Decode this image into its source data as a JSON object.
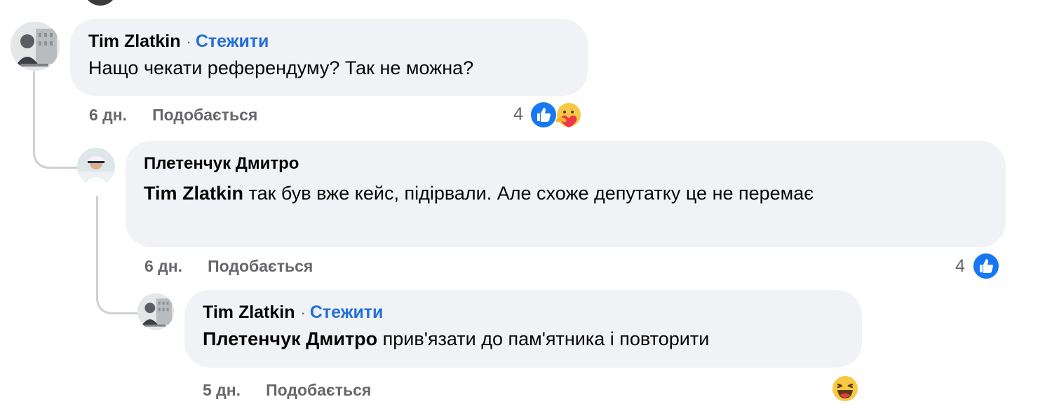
{
  "comments": [
    {
      "author": "Tim Zlatkin",
      "follow_label": "Стежити",
      "separator": "·",
      "text": "Нащо чекати референдуму? Так не можна?",
      "time": "6 дн.",
      "like_label": "Подобається",
      "reaction_count": "4",
      "reactions": [
        "like-icon",
        "care-icon"
      ]
    },
    {
      "author": "Плетенчук Дмитро",
      "mention": "Tim Zlatkin",
      "text": " так був вже кейс, підірвали. Але схоже депутатку це не перемає",
      "time": "6 дн.",
      "like_label": "Подобається",
      "reaction_count": "4",
      "reactions": [
        "like-icon"
      ]
    },
    {
      "author": "Tim Zlatkin",
      "follow_label": "Стежити",
      "separator": "·",
      "mention": "Плетенчук Дмитро",
      "text": " прив'язати до пам'ятника і повторити",
      "time": "5 дн.",
      "like_label": "Подобається",
      "reactions": [
        "haha-icon"
      ]
    }
  ],
  "colors": {
    "bubble": "#f0f2f5",
    "link": "#216fdb",
    "meta": "#65676b",
    "like_blue": "#1877f2",
    "thread_line": "#ced0d4"
  }
}
